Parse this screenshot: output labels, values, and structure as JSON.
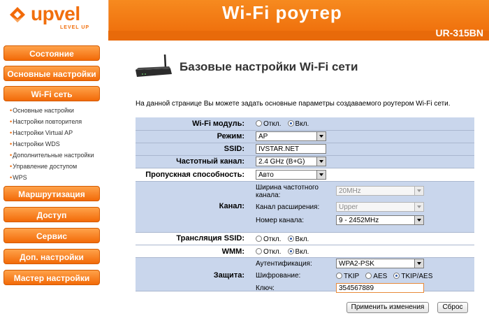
{
  "header": {
    "logo_text": "upvel",
    "logo_sub": "LEVEL UP",
    "title": "Wi-Fi роутер",
    "model": "UR-315BN",
    "brand_color": "#f26a08"
  },
  "sidebar": {
    "buttons": [
      "Состояние",
      "Основные настройки",
      "Wi-Fi сеть"
    ],
    "sub_items": [
      "Основные настройки",
      "Настройки повторителя",
      "Настройки Virtual AP",
      "Настройки WDS",
      "Дополнительные настройки",
      "Управление доступом",
      "WPS"
    ],
    "buttons_bottom": [
      "Маршрутизация",
      "Доступ",
      "Сервис",
      "Доп. настройки",
      "Мастер настройки"
    ]
  },
  "main": {
    "title": "Базовые настройки Wi-Fi сети",
    "description": "На данной странице Вы можете задать основные параметры создаваемого роутером Wi-Fi сети.",
    "wifi_module": {
      "label": "Wi-Fi модуль:",
      "off": "Откл.",
      "on": "Вкл.",
      "selected": "on"
    },
    "mode": {
      "label": "Режим:",
      "value": "AP"
    },
    "ssid": {
      "label": "SSID:",
      "value": "IVSTAR.NET"
    },
    "band": {
      "label": "Частотный канал:",
      "value": "2.4 GHz (B+G)"
    },
    "bandwidth": {
      "label": "Пропускная способность:",
      "value": "Авто"
    },
    "channel": {
      "label": "Канал:",
      "width_label": "Ширина частотного канала:",
      "width_value": "20MHz",
      "ext_label": "Канал расширения:",
      "ext_value": "Upper",
      "num_label": "Номер канала:",
      "num_value": "9 - 2452MHz"
    },
    "ssid_broadcast": {
      "label": "Трансляция SSID:",
      "off": "Откл.",
      "on": "Вкл.",
      "selected": "on"
    },
    "wmm": {
      "label": "WMM:",
      "off": "Откл.",
      "on": "Вкл.",
      "selected": "on"
    },
    "security": {
      "label": "Защита:",
      "auth_label": "Аутентификация:",
      "auth_value": "WPA2-PSK",
      "enc_label": "Шифрование:",
      "enc_options": [
        "TKIP",
        "AES",
        "TKIP/AES"
      ],
      "enc_selected": "TKIP/AES",
      "key_label": "Ключ:",
      "key_value": "354567889"
    },
    "apply_label": "Применить изменения",
    "reset_label": "Сброс"
  }
}
